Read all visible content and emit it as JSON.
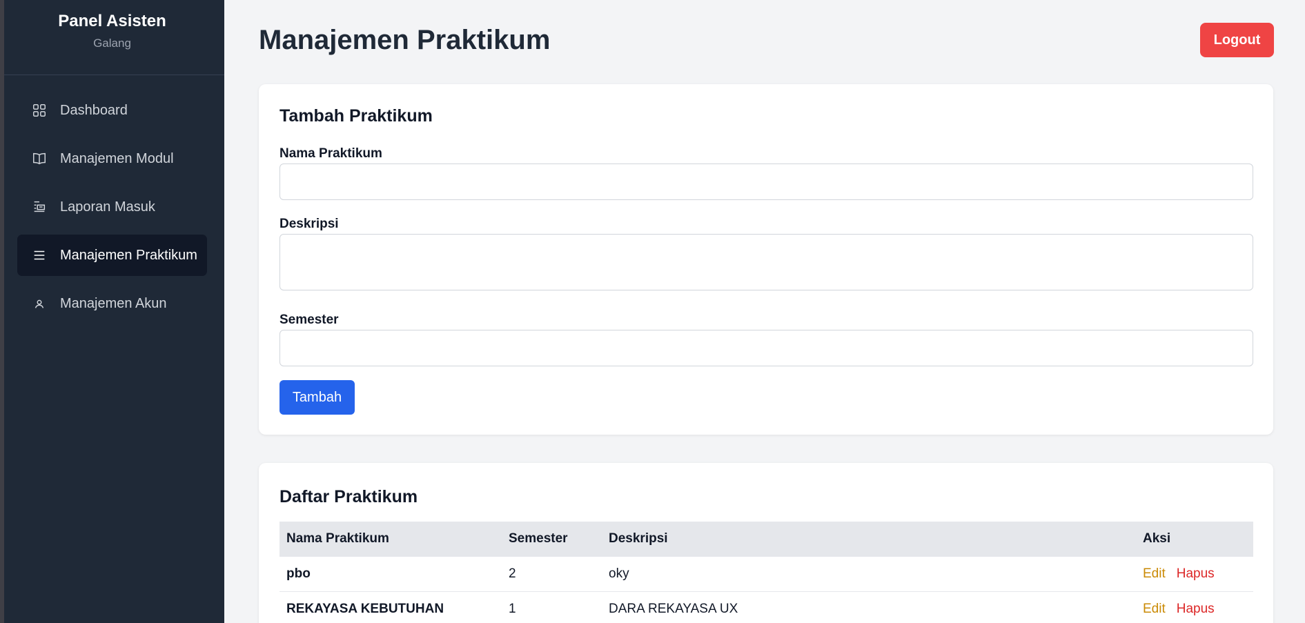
{
  "sidebar": {
    "title": "Panel Asisten",
    "user": "Galang",
    "items": [
      {
        "label": "Dashboard",
        "icon": "grid-icon",
        "active": false
      },
      {
        "label": "Manajemen Modul",
        "icon": "book-icon",
        "active": false
      },
      {
        "label": "Laporan Masuk",
        "icon": "report-icon",
        "active": false
      },
      {
        "label": "Manajemen Praktikum",
        "icon": "menu-icon",
        "active": true
      },
      {
        "label": "Manajemen Akun",
        "icon": "user-icon",
        "active": false
      }
    ]
  },
  "header": {
    "title": "Manajemen Praktikum",
    "logout_label": "Logout"
  },
  "form": {
    "title": "Tambah Praktikum",
    "name_label": "Nama Praktikum",
    "name_value": "",
    "desc_label": "Deskripsi",
    "desc_value": "",
    "semester_label": "Semester",
    "semester_value": "",
    "submit_label": "Tambah"
  },
  "list": {
    "title": "Daftar Praktikum",
    "columns": [
      "Nama Praktikum",
      "Semester",
      "Deskripsi",
      "Aksi"
    ],
    "rows": [
      {
        "name": "pbo",
        "semester": "2",
        "desc": "oky",
        "edit": "Edit",
        "delete": "Hapus"
      },
      {
        "name": "REKAYASA KEBUTUHAN",
        "semester": "1",
        "desc": "DARA REKAYASA UX",
        "edit": "Edit",
        "delete": "Hapus"
      }
    ]
  },
  "colors": {
    "sidebar_bg": "#1f2937",
    "active_item_bg": "#111827",
    "primary": "#2563eb",
    "danger": "#ef4444",
    "edit": "#ca8a04",
    "delete": "#dc2626"
  }
}
